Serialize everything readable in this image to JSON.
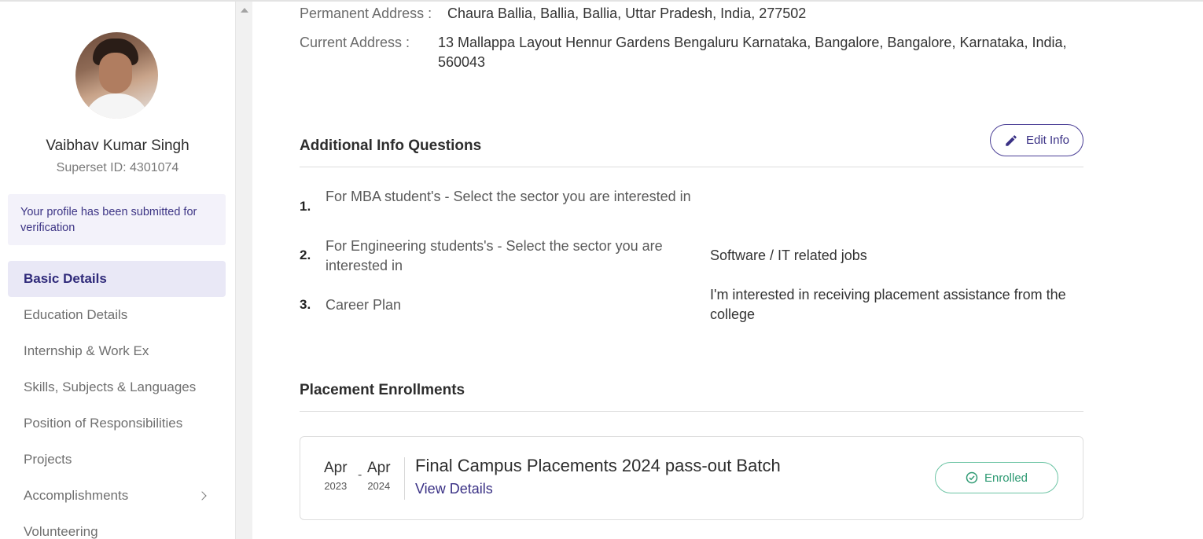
{
  "profile": {
    "name": "Vaibhav Kumar Singh",
    "superset_id": "Superset ID: 4301074",
    "notice": "Your profile has been submitted for verification"
  },
  "nav": {
    "items": [
      {
        "label": "Basic Details",
        "active": true
      },
      {
        "label": "Education Details"
      },
      {
        "label": "Internship & Work Ex"
      },
      {
        "label": "Skills, Subjects & Languages"
      },
      {
        "label": "Position of Responsibilities"
      },
      {
        "label": "Projects"
      },
      {
        "label": "Accomplishments",
        "icon": "chevron-right-icon"
      },
      {
        "label": "Volunteering"
      }
    ]
  },
  "address": {
    "permanent_label": "Permanent Address :",
    "permanent_value": "Chaura Ballia, Ballia, Ballia, Uttar Pradesh, India, 277502",
    "current_label": "Current Address :",
    "current_value": "13 Mallappa Layout Hennur Gardens Bengaluru Karnataka, Bangalore, Bangalore, Karnataka, India, 560043"
  },
  "additional_info": {
    "title": "Additional Info Questions",
    "edit_label": "Edit Info",
    "questions": [
      {
        "num": "1.",
        "question": "For MBA student's - Select the sector you are interested in",
        "answer": ""
      },
      {
        "num": "2.",
        "question": "For Engineering students's - Select the sector you are interested in",
        "answer": "Software / IT related jobs"
      },
      {
        "num": "3.",
        "question": "Career Plan",
        "answer": "I'm interested in receiving placement assistance from the college"
      }
    ]
  },
  "placements": {
    "title": "Placement Enrollments",
    "enrollment": {
      "start_month": "Apr",
      "start_year": "2023",
      "dash": "-",
      "end_month": "Apr",
      "end_year": "2024",
      "title": "Final Campus Placements 2024 pass-out Batch",
      "link": "View Details",
      "status": "Enrolled"
    }
  },
  "colors": {
    "accent": "#3a3185",
    "active_bg": "#e9e8f6",
    "enrolled": "#2e9a73"
  }
}
